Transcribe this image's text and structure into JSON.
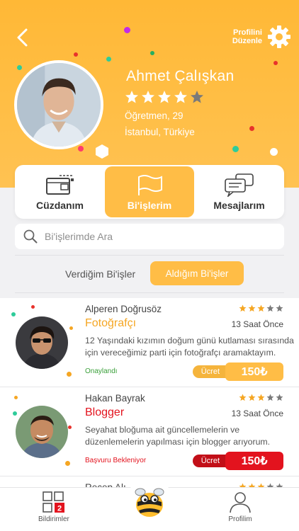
{
  "header": {
    "edit_profile_line1": "Profilini",
    "edit_profile_line2": "Düzenle"
  },
  "profile": {
    "name": "Ahmet Çalışkan",
    "rating": 4,
    "rating_max": 5,
    "occupation_age": "Öğretmen, 29",
    "location": "İstanbul, Türkiye"
  },
  "tabs": [
    {
      "label": "Cüzdanım",
      "icon": "wallet-icon"
    },
    {
      "label": "Bi'işlerim",
      "icon": "flag-icon"
    },
    {
      "label": "Mesajlarım",
      "icon": "chat-bubbles-icon"
    }
  ],
  "search": {
    "placeholder": "Bi'işlerimde Ara",
    "value": ""
  },
  "segments": {
    "given": "Verdiğim Bi'işler",
    "taken": "Aldığım Bi'işler",
    "selected": "taken"
  },
  "jobs": [
    {
      "person": "Alperen Doğrusöz",
      "rating": 3,
      "title": "Fotoğrafçı",
      "time": "13 Saat Önce",
      "description": "12 Yaşındaki kızımın doğum günü kutlaması sırasında için vereceğimiz parti için fotoğrafçı aramaktayım.",
      "status": "Onaylandı",
      "price_label": "Ücret",
      "price": "150₺",
      "accent": "#f5a623",
      "status_color": "#3aa03a"
    },
    {
      "person": "Hakan Bayrak",
      "rating": 3,
      "title": "Blogger",
      "time": "13 Saat Önce",
      "description": "Seyahat bloğuma ait güncellemelerin ve düzenlemelerin yapılması için blogger arıyorum.",
      "status": "Başvuru Bekleniyor",
      "price_label": "Ücret",
      "price": "150₺",
      "accent": "#e3131e",
      "status_color": "#e3131e"
    },
    {
      "person": "Recep Alı",
      "rating": 3
    }
  ],
  "bottom_nav": {
    "notifications_label": "Bildirimler",
    "notifications_count": "2",
    "profile_label": "Profilim"
  },
  "colors": {
    "brand": "#ffbd46",
    "star_active": "#f5a623",
    "star_inactive": "#7a7a7a"
  }
}
